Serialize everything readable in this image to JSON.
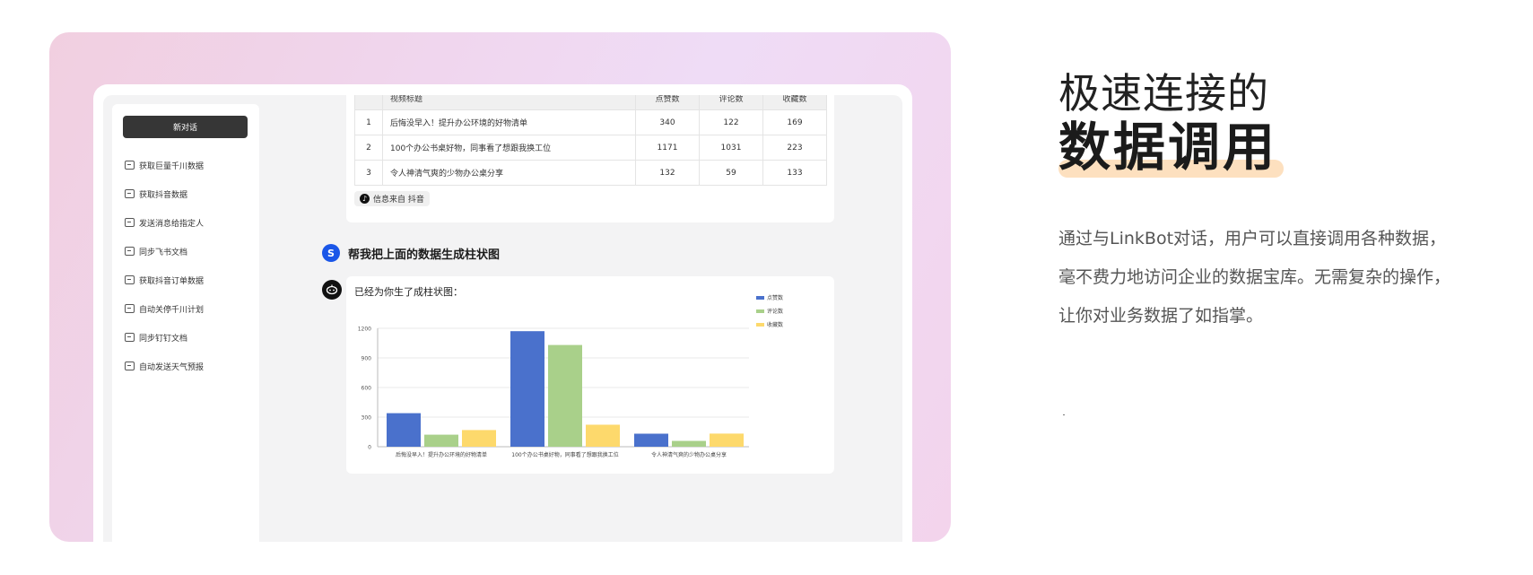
{
  "sidebar": {
    "new_chat_label": "新对话",
    "items": [
      {
        "label": "获取巨量千川数据"
      },
      {
        "label": "获取抖音数据"
      },
      {
        "label": "发送消息给指定人"
      },
      {
        "label": "同步飞书文档"
      },
      {
        "label": "获取抖音订单数据"
      },
      {
        "label": "自动关停千川计划"
      },
      {
        "label": "同步钉钉文档"
      },
      {
        "label": "自动发送天气预报"
      }
    ]
  },
  "table": {
    "headers": [
      "",
      "视频标题",
      "点赞数",
      "评论数",
      "收藏数"
    ],
    "rows": [
      [
        "1",
        "后悔没早入！提升办公环境的好物清单",
        "340",
        "122",
        "169"
      ],
      [
        "2",
        "100个办公书桌好物，同事看了想跟我换工位",
        "1171",
        "1031",
        "223"
      ],
      [
        "3",
        "令人神清气爽的少物办公桌分享",
        "132",
        "59",
        "133"
      ]
    ],
    "source_label": "信息来自 抖音"
  },
  "user_message": {
    "avatar": "S",
    "text": "帮我把上面的数据生成柱状图"
  },
  "bot_message": {
    "text": "已经为你生了成柱状图："
  },
  "colors": {
    "like": "#4a71cc",
    "comment": "#a9d08a",
    "collect": "#fdd96c",
    "accent_blue": "#1a56e8"
  },
  "chart_data": {
    "type": "bar",
    "categories": [
      "后悔没早入！提升办公环境的好物清单",
      "100个办公书桌好物，同事看了想跟我换工位",
      "令人神清气爽的少物办公桌分享"
    ],
    "series": [
      {
        "name": "点赞数",
        "values": [
          340,
          1171,
          132
        ]
      },
      {
        "name": "评论数",
        "values": [
          122,
          1031,
          59
        ]
      },
      {
        "name": "收藏数",
        "values": [
          169,
          223,
          133
        ]
      }
    ],
    "yticks": [
      "0",
      "300",
      "600",
      "900",
      "1200"
    ],
    "ylim": [
      0,
      1200
    ],
    "legend": "top-right",
    "grid": true
  },
  "hero": {
    "line1": "极速连接的",
    "line2": "数据调用",
    "description": "通过与LinkBot对话，用户可以直接调用各种数据，毫不费力地访问企业的数据宝库。无需复杂的操作，让你对业务数据了如指掌。"
  }
}
